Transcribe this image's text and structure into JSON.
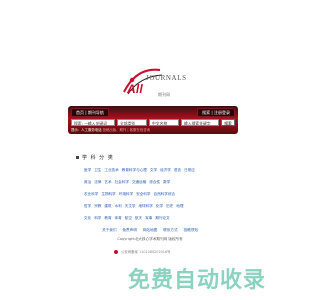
{
  "logo": {
    "brand": "All",
    "brand_alt": "JOURNALS",
    "sub": "期刊网"
  },
  "search_bar": {
    "tab_left": "首页 | 期刊导航",
    "tab_right": "搜索 | 注册登录",
    "keyword_placeholder": "搜索: 一输入关键词",
    "category_value": "全部类别",
    "field_value": "中文名称",
    "extra_value": "输入搜索关键字",
    "search_button": "搜索",
    "note_start": "提示：人工服务电话",
    "note_highlight": "投稿出版、期刊 | 客服在线咨询"
  },
  "subjects": {
    "title": "学 科 分 类",
    "rows": [
      [
        "医学",
        "卫生",
        "工业技术",
        "教育科学与心理",
        "文学",
        "经济学",
        "语言",
        "日常应"
      ],
      [
        "政治",
        "法律",
        "艺术",
        "社会科学",
        "交通运输",
        "综合性",
        "数学"
      ],
      [
        "农业科学",
        "生物科学",
        "环境科学",
        "安全科学",
        "自然科学综合"
      ],
      [
        "哲学",
        "宗教",
        "建筑",
        "水利",
        "天文学",
        "地球科学",
        "化学",
        "历史",
        "地理"
      ],
      [
        "文化",
        "科学",
        "教育",
        "体育",
        "航空",
        "航天",
        "军事",
        "期刊论文"
      ]
    ]
  },
  "footer": {
    "links": [
      "关于我们",
      "免责声明",
      "网站地图",
      "联系方式",
      "投稿须知"
    ],
    "copyright": "Copyright北大核心学术期刊网 版权所有",
    "police": "公安网备案 1101080202016号"
  },
  "watermark": "免费自动收录"
}
